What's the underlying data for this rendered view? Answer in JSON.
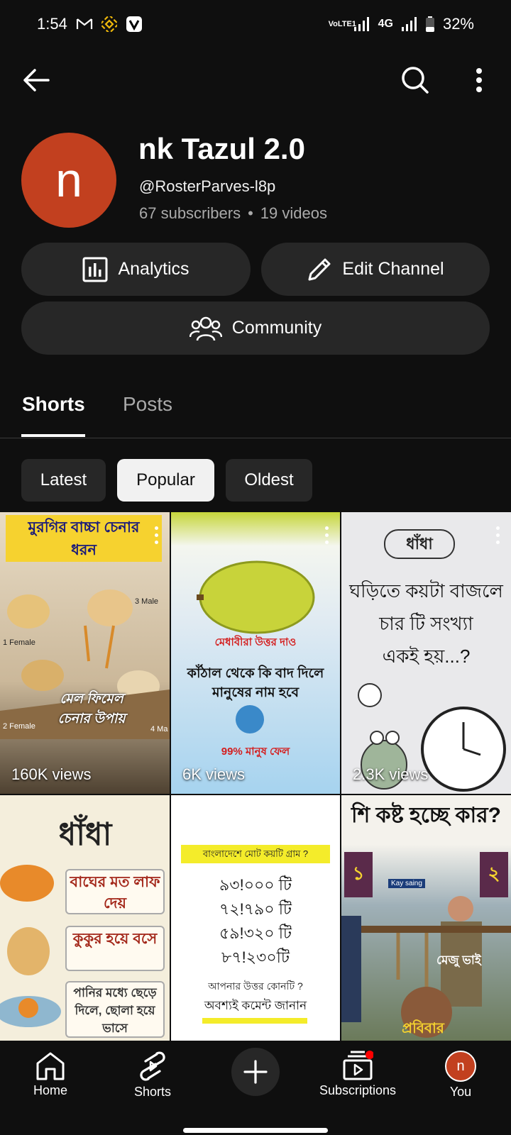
{
  "status_bar": {
    "time": "1:54",
    "volte_label": "VoLTE1",
    "network_label": "4G",
    "battery": "32%"
  },
  "channel": {
    "avatar_letter": "n",
    "name": "nk Tazul 2.0",
    "handle": "@RosterParves-l8p",
    "subscribers": "67 subscribers",
    "separator": "•",
    "videos": "19 videos"
  },
  "actions": {
    "analytics_label": "Analytics",
    "edit_label": "Edit Channel",
    "community_label": "Community"
  },
  "tabs": {
    "shorts": "Shorts",
    "posts": "Posts"
  },
  "chips": {
    "latest": "Latest",
    "popular": "Popular",
    "oldest": "Oldest"
  },
  "shorts": [
    {
      "views": "160K views",
      "title_1": "মুরগির বাচ্চা চেনার",
      "title_2": "ধরন",
      "caption_1": "মেল ফিমেল",
      "caption_2": "চেনার উপায়",
      "label_female": "1 Female",
      "label_male": "3 Male",
      "label_2": "2 Female",
      "label_4": "4 Ma"
    },
    {
      "views": "6K views",
      "line_1": "মেধাবীরা উত্তর দাও",
      "line_2": "কাঁঠাল থেকে কি বাদ দিলে",
      "line_3": "মানুষের নাম হবে",
      "line_4": "99% মানুষ ফেল"
    },
    {
      "views": "2.3K views",
      "badge": "ধাঁধা",
      "line_1": "ঘড়িতে কয়টা বাজলে",
      "line_2": "চার টি সংখ্যা",
      "line_3": "একই হয়...?"
    },
    {
      "title": "ধাঁধা",
      "opt_1": "বাঘের মত লাফ দেয়",
      "opt_2": "কুকুর হয়ে বসে",
      "opt_3": "পানির মধ্যে ছেড়ে দিলে, ছোলা হয়ে ভাসে"
    },
    {
      "header": "বাংলাদেশে মোট কয়টি গ্রাম ?",
      "opt_1": "৯৩!০০০ টি",
      "opt_2": "৭২!৭৯০ টি",
      "opt_3": "৫৯!৩২০ টি",
      "opt_4": "৮৭!২৩০টি",
      "q": "আপনার উত্তর কোনটি ?",
      "cta": "অবশ্যই কমেন্ট জানান"
    },
    {
      "header": "শি কষ্ট হচ্ছে কার?",
      "badge_1": "১",
      "badge_2": "২",
      "tag": "Kay saing",
      "label": "মেজু ভাই",
      "footer": "প্রবিবার"
    }
  ],
  "bottom_nav": {
    "home": "Home",
    "shorts": "Shorts",
    "subscriptions": "Subscriptions",
    "you": "You",
    "you_avatar_letter": "n"
  }
}
